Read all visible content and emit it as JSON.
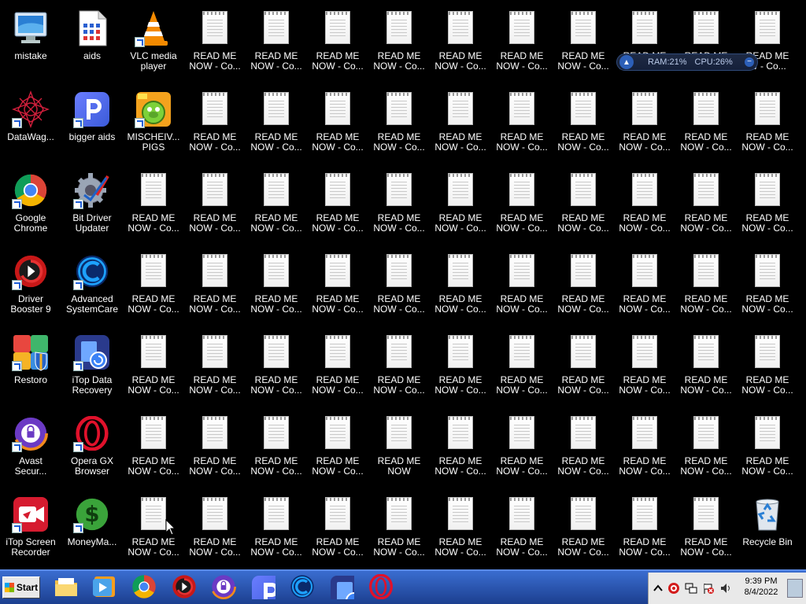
{
  "desktop": {
    "column1": [
      {
        "label": "mistake",
        "icon": "computer-icon"
      },
      {
        "label": "DataWag...",
        "icon": "datawag-icon"
      },
      {
        "label": "Google\nChrome",
        "icon": "chrome-icon"
      },
      {
        "label": "Driver\nBooster 9",
        "icon": "driver-booster-icon"
      },
      {
        "label": "Restoro",
        "icon": "restoro-icon"
      },
      {
        "label": "Avast\nSecur...",
        "icon": "avast-icon"
      },
      {
        "label": "iTop Screen\nRecorder",
        "icon": "itop-recorder-icon"
      }
    ],
    "column2": [
      {
        "label": "aids",
        "icon": "document-icon"
      },
      {
        "label": "bigger aids",
        "icon": "p-app-icon"
      },
      {
        "label": "Bit Driver\nUpdater",
        "icon": "bit-driver-icon"
      },
      {
        "label": "Advanced\nSystemCare",
        "icon": "advanced-systemcare-icon"
      },
      {
        "label": "iTop Data\nRecovery",
        "icon": "itop-data-icon"
      },
      {
        "label": "Opera GX\nBrowser",
        "icon": "opera-icon"
      },
      {
        "label": "MoneyMa...",
        "icon": "money-icon"
      }
    ],
    "column3_extra": [
      {
        "label": "VLC media\nplayer",
        "icon": "vlc-icon"
      },
      {
        "label": "MISCHEIV...\nPIGS",
        "icon": "pigs-icon"
      }
    ],
    "readme_label": "READ ME\nNOW - Co...",
    "readme_label_short": "READ ME\nNOW",
    "readme_label_cut": "READ ME\nW - Co...",
    "recycle_bin": "Recycle Bin"
  },
  "widget": {
    "ram": "RAM:21%",
    "cpu": "CPU:26%"
  },
  "taskbar": {
    "start_label": "Start",
    "pinned": [
      "explorer-icon",
      "media-player-icon",
      "chrome-icon",
      "driver-booster-icon",
      "avast-icon",
      "p-app-icon",
      "advanced-systemcare-icon",
      "itop-data-icon",
      "opera-icon"
    ],
    "time": "9:39 PM",
    "date": "8/4/2022"
  },
  "colors": {
    "desktop_bg": "#000000",
    "taskbar": "#2a54b0"
  }
}
